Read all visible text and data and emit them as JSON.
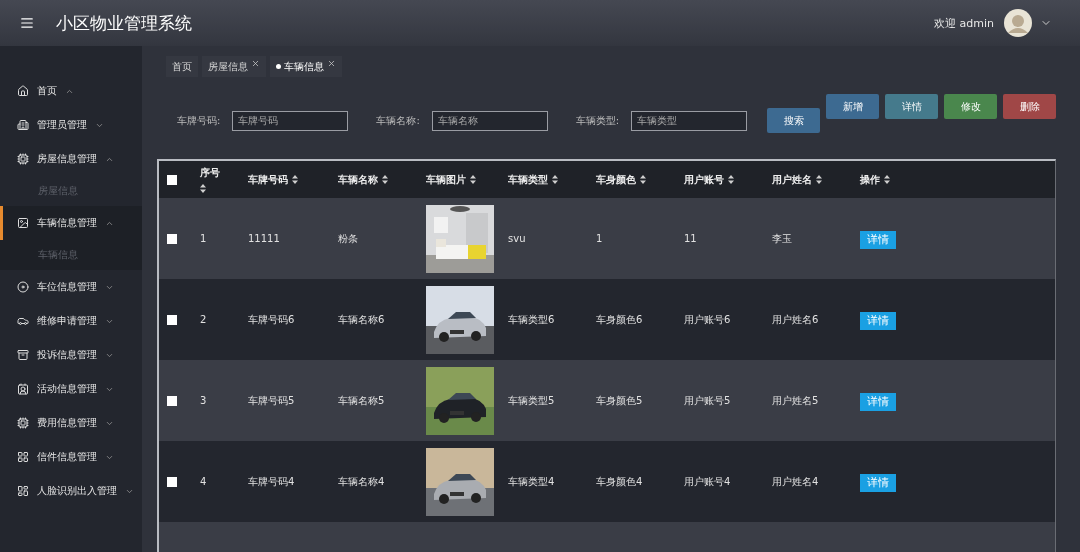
{
  "header": {
    "title": "小区物业管理系统",
    "welcome": "欢迎 admin"
  },
  "sidebar": {
    "items": [
      {
        "label": "首页",
        "expanded": true,
        "selected": false
      },
      {
        "label": "管理员管理",
        "expanded": false,
        "selected": false
      },
      {
        "label": "房屋信息管理",
        "expanded": true,
        "selected": false,
        "children": [
          {
            "label": "房屋信息",
            "selected": false
          }
        ]
      },
      {
        "label": "车辆信息管理",
        "expanded": true,
        "selected": true,
        "children": [
          {
            "label": "车辆信息",
            "selected": false
          }
        ]
      },
      {
        "label": "车位信息管理",
        "expanded": false,
        "selected": false
      },
      {
        "label": "维修申请管理",
        "expanded": false,
        "selected": false
      },
      {
        "label": "投诉信息管理",
        "expanded": false,
        "selected": false
      },
      {
        "label": "活动信息管理",
        "expanded": false,
        "selected": false
      },
      {
        "label": "费用信息管理",
        "expanded": false,
        "selected": false
      },
      {
        "label": "信件信息管理",
        "expanded": false,
        "selected": false
      },
      {
        "label": "人脸识别出入管理",
        "expanded": false,
        "selected": false
      }
    ]
  },
  "tabs": [
    {
      "label": "首页",
      "selected": false,
      "closable": false
    },
    {
      "label": "房屋信息",
      "selected": false,
      "closable": true
    },
    {
      "label": "车辆信息",
      "selected": true,
      "closable": true
    }
  ],
  "search": {
    "fields": [
      {
        "label": "车牌号码:",
        "placeholder": "车牌号码"
      },
      {
        "label": "车辆名称:",
        "placeholder": "车辆名称"
      },
      {
        "label": "车辆类型:",
        "placeholder": "车辆类型"
      }
    ],
    "button": "搜索"
  },
  "actions": [
    {
      "label": "新增",
      "color": "#3d6a91"
    },
    {
      "label": "详情",
      "color": "#457a8c"
    },
    {
      "label": "修改",
      "color": "#4a874d"
    },
    {
      "label": "删除",
      "color": "#a04747"
    }
  ],
  "table": {
    "all_checked": false,
    "columns": [
      "序号",
      "车牌号码",
      "车辆名称",
      "车辆图片",
      "车辆类型",
      "车身颜色",
      "用户账号",
      "用户姓名",
      "操作"
    ],
    "rows": [
      {
        "checked": false,
        "cells": [
          "1",
          "11111",
          "粉条",
          {
            "kind": "picture"
          },
          "svu",
          "1",
          "11",
          "李玉"
        ],
        "action": "详情"
      },
      {
        "checked": false,
        "cells": [
          "2",
          "车牌号码6",
          "车辆名称6",
          {
            "kind": "picture"
          },
          "车辆类型6",
          "车身颜色6",
          "用户账号6",
          "用户姓名6"
        ],
        "action": "详情"
      },
      {
        "checked": false,
        "cells": [
          "3",
          "车牌号码5",
          "车辆名称5",
          {
            "kind": "picture"
          },
          "车辆类型5",
          "车身颜色5",
          "用户账号5",
          "用户姓名5"
        ],
        "action": "详情"
      },
      {
        "checked": false,
        "cells": [
          "4",
          "车牌号码4",
          "车辆名称4",
          {
            "kind": "picture"
          },
          "车辆类型4",
          "车身颜色4",
          "用户账号4",
          "用户姓名4"
        ],
        "action": "详情"
      }
    ]
  }
}
